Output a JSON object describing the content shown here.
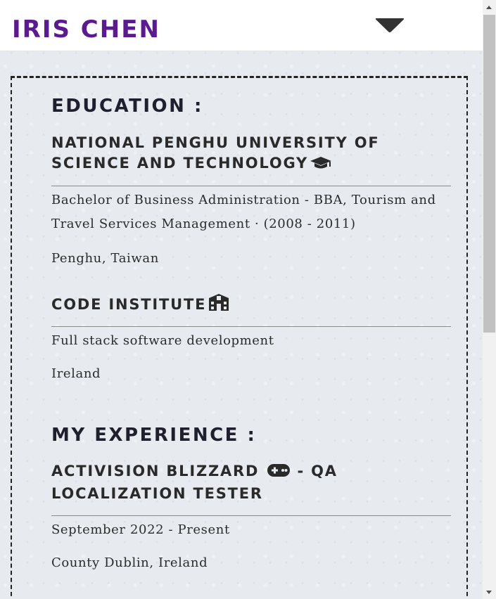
{
  "navbar": {
    "brand": "IRIS CHEN",
    "toggle_icon": "caret-down-icon"
  },
  "education": {
    "heading": "EDUCATION :",
    "schools": [
      {
        "name": "NATIONAL PENGHU UNIVERSITY OF SCIENCE AND TECHNOLOGY",
        "icon": "graduation-cap-icon",
        "degree": "Bachelor of Business Administration - BBA, Tourism and Travel Services Management · (2008 - 2011)",
        "location": "Penghu, Taiwan"
      },
      {
        "name": "CODE INSTITUTE",
        "icon": "school-icon",
        "degree": "Full stack software development",
        "location": "Ireland"
      }
    ]
  },
  "experience": {
    "heading": "MY EXPERIENCE :",
    "jobs": [
      {
        "company": "ACTIVISION BLIZZARD",
        "icon": "gamepad-icon",
        "role": "- QA LOCALIZATION TESTER",
        "period": "September 2022 - Present",
        "location": "County Dublin, Ireland"
      }
    ]
  },
  "colors": {
    "brand": "#5b1a8e",
    "heading": "#1f1f2e",
    "background": "#e7ebef"
  }
}
